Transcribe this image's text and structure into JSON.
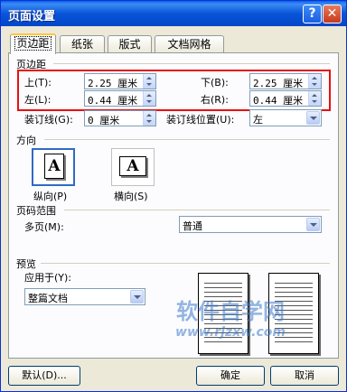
{
  "window": {
    "title": "页面设置",
    "help_label": "?",
    "close_label": "✕"
  },
  "tabs": [
    {
      "label": "页边距"
    },
    {
      "label": "纸张"
    },
    {
      "label": "版式"
    },
    {
      "label": "文档网格"
    }
  ],
  "margins": {
    "group_label": "页边距",
    "top": {
      "label": "上(T):",
      "value": "2.25 厘米"
    },
    "bottom": {
      "label": "下(B):",
      "value": "2.25 厘米"
    },
    "left": {
      "label": "左(L):",
      "value": "0.44 厘米"
    },
    "right": {
      "label": "右(R):",
      "value": "0.44 厘米"
    },
    "gutter": {
      "label": "装订线(G):",
      "value": "0 厘米"
    },
    "gutter_position": {
      "label": "装订线位置(U):",
      "value": "左"
    }
  },
  "orientation": {
    "group_label": "方向",
    "portrait": {
      "label": "纵向(P)",
      "glyph": "A"
    },
    "landscape": {
      "label": "横向(S)",
      "glyph": "A"
    }
  },
  "pages": {
    "group_label": "页码范围",
    "multiple_label": "多页(M):",
    "multiple_value": "普通"
  },
  "preview": {
    "group_label": "预览",
    "apply_label": "应用于(Y):",
    "apply_value": "整篇文档"
  },
  "watermark": {
    "line1": "软件自学网",
    "line2": "www.rjzxw.com"
  },
  "buttons": {
    "default": "默认(D)...",
    "ok": "确定",
    "cancel": "取消"
  },
  "accent_colors": {
    "highlight_box": "#e81010",
    "title_bar": "#0a55d8"
  }
}
